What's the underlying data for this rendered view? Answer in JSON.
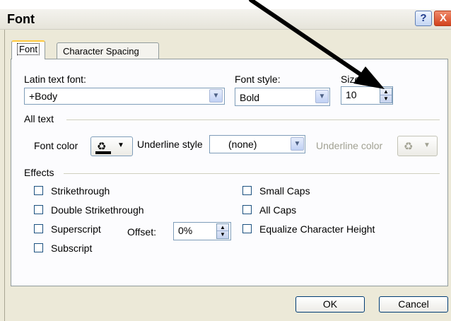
{
  "window": {
    "title": "Font",
    "help_label": "?",
    "close_label": "X"
  },
  "tabs": [
    {
      "label": "Font",
      "selected": true
    },
    {
      "label": "Character Spacing",
      "selected": false
    }
  ],
  "font": {
    "latin_label": "Latin text font:",
    "latin_value": "+Body",
    "style_label": "Font style:",
    "style_value": "Bold",
    "size_label": "Size:",
    "size_value": "10"
  },
  "all_text": {
    "heading": "All text",
    "font_color_label": "Font color",
    "underline_style_label": "Underline style",
    "underline_style_value": "(none)",
    "underline_color_label": "Underline color"
  },
  "effects": {
    "heading": "Effects",
    "strikethrough": "Strikethrough",
    "double_strikethrough": "Double Strikethrough",
    "superscript": "Superscript",
    "offset_label": "Offset:",
    "offset_value": "0%",
    "subscript": "Subscript",
    "small_caps": "Small Caps",
    "all_caps": "All Caps",
    "equalize_height": "Equalize Character Height"
  },
  "buttons": {
    "ok": "OK",
    "cancel": "Cancel"
  },
  "colors": {
    "font_color_swatch": "#000000",
    "annotation_arrow": "#000000"
  },
  "icons": {
    "font_color": "paint-bucket-icon",
    "underline_color": "paint-bucket-icon",
    "dropdown": "chevron-down-icon",
    "spinner": "spinner-arrows-icon"
  }
}
